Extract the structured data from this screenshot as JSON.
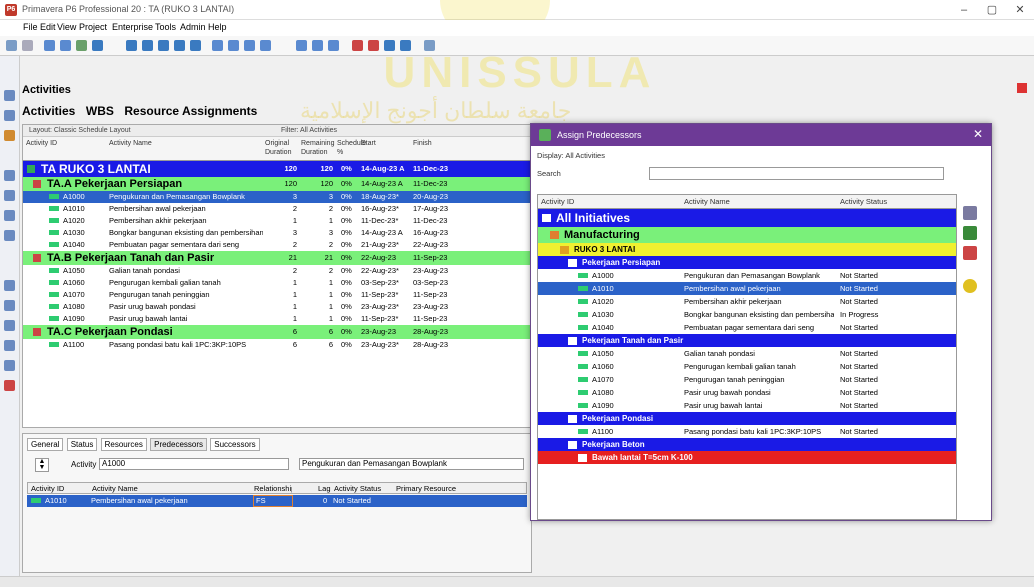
{
  "window": {
    "title": "Primavera P6 Professional 20 : TA (RUKO 3 LANTAI)",
    "app_icon": "P6"
  },
  "menu": [
    "File",
    "Edit",
    "View",
    "Project",
    "Enterprise",
    "Tools",
    "Admin",
    "Help"
  ],
  "watermark": {
    "text": "UNISSULA",
    "arabic": "جامعة سلطان أجونج الإسلامية"
  },
  "main": {
    "section_title": "Activities",
    "tabs": [
      "Activities",
      "WBS",
      "Resource Assignments"
    ],
    "layout_label": "Layout: Classic Schedule Layout",
    "filter_label": "Filter: All Activities",
    "columns": [
      "Activity ID",
      "Activity Name",
      "Original Duration",
      "Remaining Duration",
      "Schedule %",
      "Start",
      "Finish"
    ],
    "project": {
      "id": "TA RUKO 3 LANTAI",
      "od": "120",
      "rd": "120",
      "pct": "0%",
      "start": "14-Aug-23 A",
      "finish": "11-Dec-23"
    },
    "groups": [
      {
        "name": "TA.A  Pekerjaan Persiapan",
        "od": "120",
        "rd": "120",
        "pct": "0%",
        "start": "14-Aug-23 A",
        "finish": "11-Dec-23",
        "rows": [
          {
            "id": "A1000",
            "name": "Pengukuran dan Pemasangan Bowplank",
            "od": "3",
            "rd": "3",
            "pct": "0%",
            "start": "18-Aug-23*",
            "finish": "20-Aug-23",
            "selected": true
          },
          {
            "id": "A1010",
            "name": "Pembersihan awal pekerjaan",
            "od": "2",
            "rd": "2",
            "pct": "0%",
            "start": "16-Aug-23*",
            "finish": "17-Aug-23"
          },
          {
            "id": "A1020",
            "name": "Pembersihan akhir pekerjaan",
            "od": "1",
            "rd": "1",
            "pct": "0%",
            "start": "11-Dec-23*",
            "finish": "11-Dec-23"
          },
          {
            "id": "A1030",
            "name": "Bongkar bangunan eksisting dan pembersihan",
            "od": "3",
            "rd": "3",
            "pct": "0%",
            "start": "14-Aug-23 A",
            "finish": "16-Aug-23"
          },
          {
            "id": "A1040",
            "name": "Pembuatan pagar sementara dari seng",
            "od": "2",
            "rd": "2",
            "pct": "0%",
            "start": "21-Aug-23*",
            "finish": "22-Aug-23"
          }
        ]
      },
      {
        "name": "TA.B  Pekerjaan Tanah dan Pasir",
        "od": "21",
        "rd": "21",
        "pct": "0%",
        "start": "22-Aug-23",
        "finish": "11-Sep-23",
        "rows": [
          {
            "id": "A1050",
            "name": "Galian tanah pondasi",
            "od": "2",
            "rd": "2",
            "pct": "0%",
            "start": "22-Aug-23*",
            "finish": "23-Aug-23"
          },
          {
            "id": "A1060",
            "name": "Pengurugan kembali galian tanah",
            "od": "1",
            "rd": "1",
            "pct": "0%",
            "start": "03-Sep-23*",
            "finish": "03-Sep-23"
          },
          {
            "id": "A1070",
            "name": "Pengurugan tanah peninggian",
            "od": "1",
            "rd": "1",
            "pct": "0%",
            "start": "11-Sep-23*",
            "finish": "11-Sep-23"
          },
          {
            "id": "A1080",
            "name": "Pasir urug bawah pondasi",
            "od": "1",
            "rd": "1",
            "pct": "0%",
            "start": "23-Aug-23*",
            "finish": "23-Aug-23"
          },
          {
            "id": "A1090",
            "name": "Pasir urug bawah lantai",
            "od": "1",
            "rd": "1",
            "pct": "0%",
            "start": "11-Sep-23*",
            "finish": "11-Sep-23"
          }
        ]
      },
      {
        "name": "TA.C  Pekerjaan Pondasi",
        "od": "6",
        "rd": "6",
        "pct": "0%",
        "start": "23-Aug-23",
        "finish": "28-Aug-23",
        "rows": [
          {
            "id": "A1100",
            "name": "Pasang pondasi batu kali 1PC:3KP:10PS",
            "od": "6",
            "rd": "6",
            "pct": "0%",
            "start": "23-Aug-23*",
            "finish": "28-Aug-23"
          }
        ]
      }
    ]
  },
  "detail": {
    "tabs": [
      "General",
      "Status",
      "Resources",
      "Predecessors",
      "Successors"
    ],
    "activity_label": "Activity",
    "activity_id": "A1000",
    "activity_name": "Pengukuran dan Pemasangan Bowplank",
    "columns": [
      "Activity ID",
      "Activity Name",
      "Relationship",
      "Lag",
      "Activity Status",
      "Primary Resource"
    ],
    "row": {
      "id": "A1010",
      "name": "Pembersihan awal pekerjaan",
      "rel": "FS",
      "lag": "0",
      "status": "Not Started"
    }
  },
  "dialog": {
    "title": "Assign Predecessors",
    "display": "Display: All Activities",
    "search_label": "Search",
    "columns": [
      "Activity ID",
      "Activity Name",
      "Activity Status"
    ],
    "initiatives": "All Initiatives",
    "manufacturing": "Manufacturing",
    "project": "RUKO 3 LANTAI",
    "wbs1": "Pekerjaan Persiapan",
    "rows1": [
      {
        "id": "A1000",
        "name": "Pengukuran dan Pemasangan Bowplank",
        "status": "Not Started"
      },
      {
        "id": "A1010",
        "name": "Pembersihan awal pekerjaan",
        "status": "Not Started",
        "selected": true
      },
      {
        "id": "A1020",
        "name": "Pembersihan akhir pekerjaan",
        "status": "Not Started"
      },
      {
        "id": "A1030",
        "name": "Bongkar bangunan eksisting dan pembersihan",
        "status": "In Progress"
      },
      {
        "id": "A1040",
        "name": "Pembuatan pagar sementara dari seng",
        "status": "Not Started"
      }
    ],
    "wbs2": "Pekerjaan Tanah dan Pasir",
    "rows2": [
      {
        "id": "A1050",
        "name": "Galian tanah pondasi",
        "status": "Not Started"
      },
      {
        "id": "A1060",
        "name": "Pengurugan kembali galian tanah",
        "status": "Not Started"
      },
      {
        "id": "A1070",
        "name": "Pengurugan tanah peninggian",
        "status": "Not Started"
      },
      {
        "id": "A1080",
        "name": "Pasir urug bawah pondasi",
        "status": "Not Started"
      },
      {
        "id": "A1090",
        "name": "Pasir urug bawah lantai",
        "status": "Not Started"
      }
    ],
    "wbs3": "Pekerjaan Pondasi",
    "rows3": [
      {
        "id": "A1100",
        "name": "Pasang pondasi batu kali 1PC:3KP:10PS",
        "status": "Not Started"
      }
    ],
    "wbs4": "Pekerjaan Beton",
    "wbs5": "Bawah lantai T=5cm K-100"
  }
}
